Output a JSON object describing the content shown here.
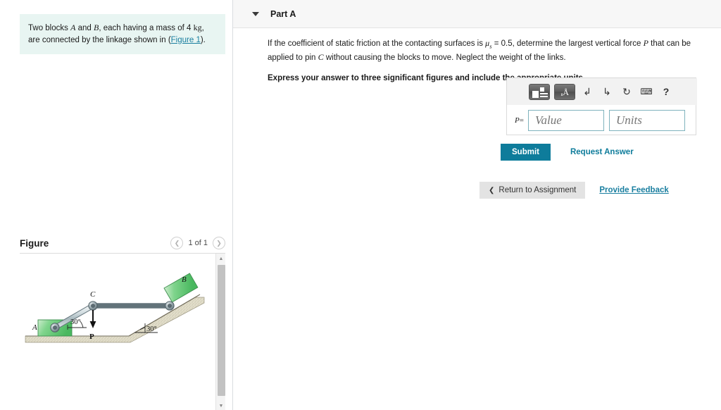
{
  "problem": {
    "text_part1": "Two blocks ",
    "var_a": "A",
    "text_and": " and ",
    "var_b": "B",
    "text_part2": ", each having a mass of 4 ",
    "unit_kg": "kg",
    "text_part3": ", are connected by the linkage shown in (",
    "figure_link": "Figure 1",
    "text_part4": ")."
  },
  "figure": {
    "title": "Figure",
    "pager_label": "1 of 1",
    "prev_icon": "chevron-left-icon",
    "next_icon": "chevron-right-icon",
    "diagram": {
      "label_a": "A",
      "label_b": "B",
      "label_c": "C",
      "label_force": "P",
      "angle_link": "30°",
      "angle_incline": "30°"
    }
  },
  "part": {
    "caret_icon": "caret-down-icon",
    "title": "Part A",
    "question_prefix": "If the coefficient of static friction at the contacting surfaces is ",
    "mu_symbol": "μ",
    "mu_subscript": "s",
    "mu_value": " = 0.5, determine the largest vertical force ",
    "force_symbol": "P",
    "question_mid": " that can be applied to pin ",
    "pin_symbol": "C",
    "question_suffix": " without causing the blocks to move. Neglect the weight of the links.",
    "instruction": "Express your answer to three significant figures and include the appropriate units."
  },
  "answer": {
    "toolbar": [
      {
        "name": "template-button",
        "type": "gfx-template"
      },
      {
        "name": "units-button",
        "type": "gfx-units",
        "glyph": "Å"
      },
      {
        "name": "undo-icon",
        "glyph": "↰"
      },
      {
        "name": "redo-icon",
        "glyph": "↱"
      },
      {
        "name": "reset-icon",
        "glyph": "↻"
      },
      {
        "name": "keyboard-icon",
        "glyph": "⌨"
      },
      {
        "name": "help-icon",
        "glyph": "?"
      }
    ],
    "p_label": "P",
    "equals": "=",
    "value_placeholder": "Value",
    "units_placeholder": "Units"
  },
  "actions": {
    "submit_label": "Submit",
    "request_answer_label": "Request Answer",
    "return_chevron": "❮",
    "return_label": "Return to Assignment",
    "provide_feedback_label": "Provide Feedback"
  },
  "colors": {
    "accent": "#0e7c9b",
    "link": "#1a7fa0",
    "problem_bg": "#e8f5f2",
    "header_bg": "#f7f7f7",
    "block_green": "#7ed48a",
    "ground_beige": "#ddd9c3"
  }
}
